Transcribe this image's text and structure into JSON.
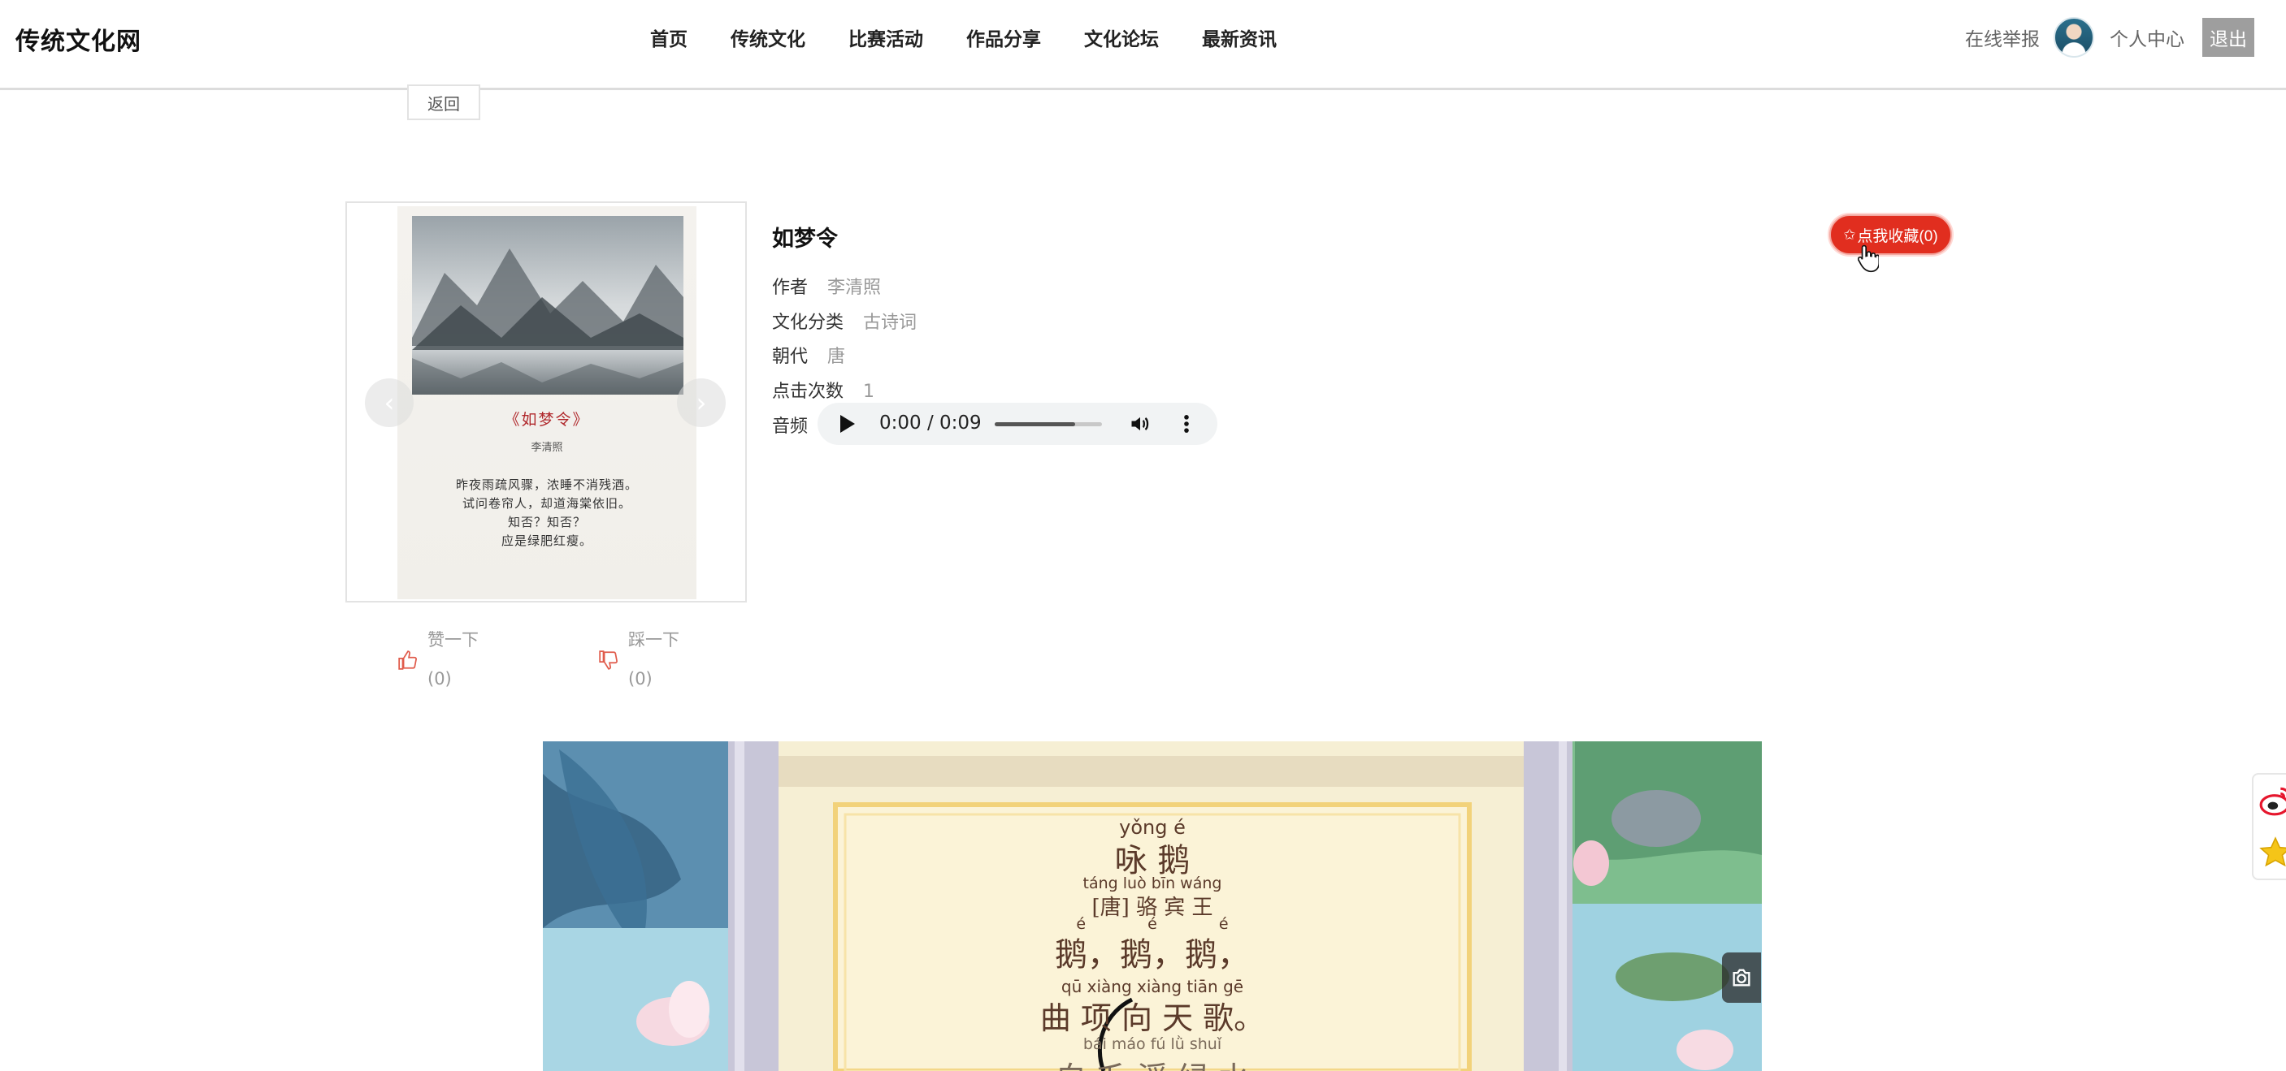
{
  "header": {
    "logo": "传统文化网",
    "nav": [
      "首页",
      "传统文化",
      "比赛活动",
      "作品分享",
      "文化论坛",
      "最新资讯"
    ],
    "report_label": "在线举报",
    "user_center_label": "个人中心",
    "logout_label": "退出"
  },
  "back_label": "返回",
  "carousel": {
    "title": "《如梦令》",
    "author": "李清照",
    "lines": [
      "昨夜雨疏风骤，浓睡不消残酒。",
      "试问卷帘人，却道海棠依旧。",
      "知否？知否？",
      "应是绿肥红瘦。"
    ],
    "prev_symbol": "‹",
    "next_symbol": "›"
  },
  "work": {
    "title": "如梦令",
    "fields": [
      {
        "label": "作者",
        "value": "李清照"
      },
      {
        "label": "文化分类",
        "value": "古诗词"
      },
      {
        "label": "朝代",
        "value": "唐"
      },
      {
        "label": "点击次数",
        "value": "1"
      }
    ],
    "audio_label": "音频"
  },
  "audio": {
    "time": "0:00 / 0:09",
    "volume_level": 0.75
  },
  "favorite": {
    "label": "点我收藏(0)",
    "star_symbol": "✩"
  },
  "vote": {
    "like_label": "赞一下",
    "like_count": "(0)",
    "dislike_label": "踩一下",
    "dislike_count": "(0)"
  },
  "video": {
    "title_pinyin": "yǒng é",
    "title": "咏 鹅",
    "author_pinyin": "táng luò bīn wáng",
    "author": "[唐] 骆 宾 王",
    "line1_pinyin": "é é é",
    "line1": "鹅，鹅，鹅，",
    "line2_pinyin": "qū xiàng xiàng tiān gē",
    "line2": "曲 项 向 天 歌。",
    "line3_pinyin": "bái máo fú lǜ shuǐ",
    "line3": "白 毛 浮 绿 水"
  },
  "colors": {
    "accent_red": "#e12e1f",
    "logout_gray": "#9e9e9e",
    "like_red": "#e05b4b"
  },
  "icons": {
    "like": "thumbs-up-icon",
    "dislike": "thumbs-down-icon",
    "snapshot": "camera-icon",
    "weibo": "weibo-icon",
    "favorite": "star-icon"
  }
}
